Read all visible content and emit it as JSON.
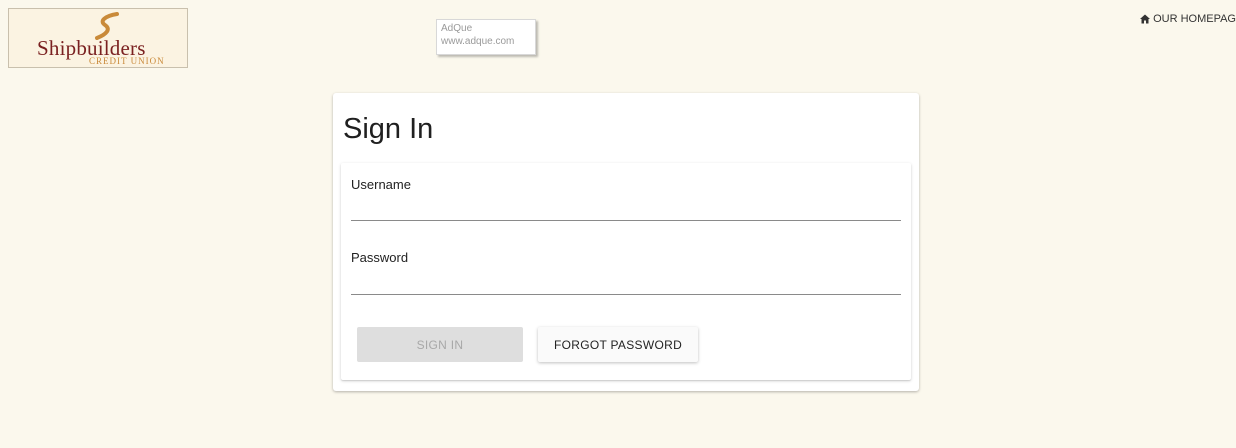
{
  "logo": {
    "name": "Shipbuilders",
    "subtitle": "CREDIT UNION"
  },
  "ad": {
    "title": "AdQue",
    "url": "www.adque.com"
  },
  "header": {
    "homepage_label": "OUR HOMEPAG",
    "homepage_icon": "home-icon"
  },
  "signin": {
    "title": "Sign In",
    "username_label": "Username",
    "username_value": "",
    "password_label": "Password",
    "password_value": "",
    "signin_button": "SIGN IN",
    "forgot_button": "FORGOT PASSWORD"
  },
  "colors": {
    "background": "#fbf8ed",
    "brand": "#7a2020",
    "brand_accent": "#c98a3a",
    "disabled_button": "#dedede"
  }
}
